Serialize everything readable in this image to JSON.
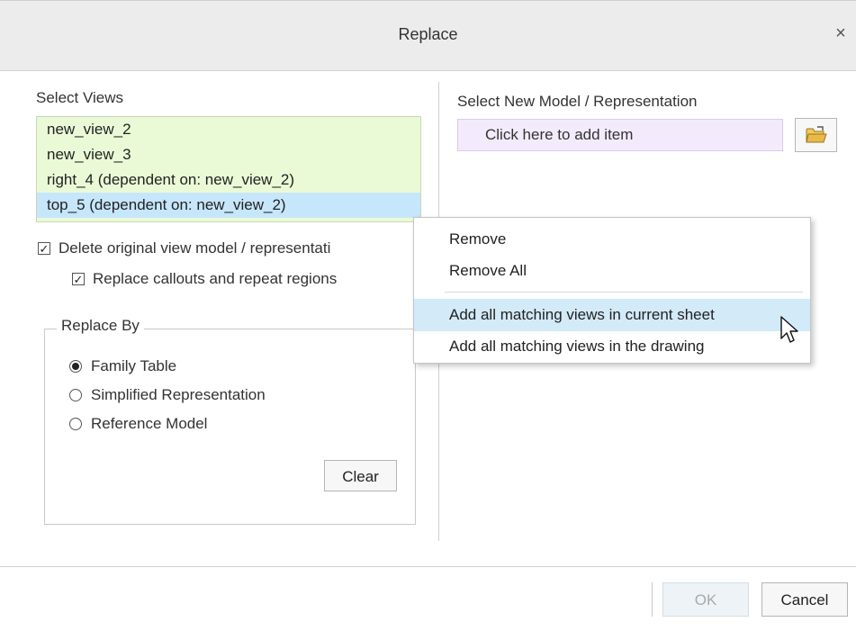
{
  "window": {
    "title": "Replace",
    "close_glyph": "×"
  },
  "left_panel": {
    "select_views_label": "Select Views",
    "views": [
      {
        "label": "new_view_2",
        "selected": false
      },
      {
        "label": "new_view_3",
        "selected": false
      },
      {
        "label": "right_4 (dependent on: new_view_2)",
        "selected": false
      },
      {
        "label": "top_5 (dependent on: new_view_2)",
        "selected": true
      }
    ],
    "delete_original_label": "Delete original view model / representati",
    "delete_original_checked": true,
    "replace_callouts_label": "Replace callouts and repeat regions",
    "replace_callouts_checked": true,
    "replace_by": {
      "title": "Replace By",
      "options": [
        {
          "label": "Family Table",
          "selected": true
        },
        {
          "label": "Simplified Representation",
          "selected": false
        },
        {
          "label": "Reference Model",
          "selected": false
        }
      ],
      "clear_label": "Clear"
    }
  },
  "right_panel": {
    "select_model_label": "Select New Model / Representation",
    "add_item_placeholder": "Click here to add item",
    "folder_icon": "open-folder-icon"
  },
  "context_menu": {
    "items": [
      {
        "label": "Remove",
        "hover": false
      },
      {
        "label": "Remove All",
        "hover": false
      },
      {
        "label": "Add all matching views in current sheet",
        "hover": true
      },
      {
        "label": "Add all matching views in the drawing",
        "hover": false
      }
    ]
  },
  "footer": {
    "ok_label": "OK",
    "ok_enabled": false,
    "cancel_label": "Cancel"
  },
  "colors": {
    "list_background": "#eafad7",
    "list_selected": "#c6e6fb",
    "add_item_background": "#f3ebfb",
    "menu_hover": "#d3eaf8",
    "folder_icon": "#e9b94a"
  }
}
